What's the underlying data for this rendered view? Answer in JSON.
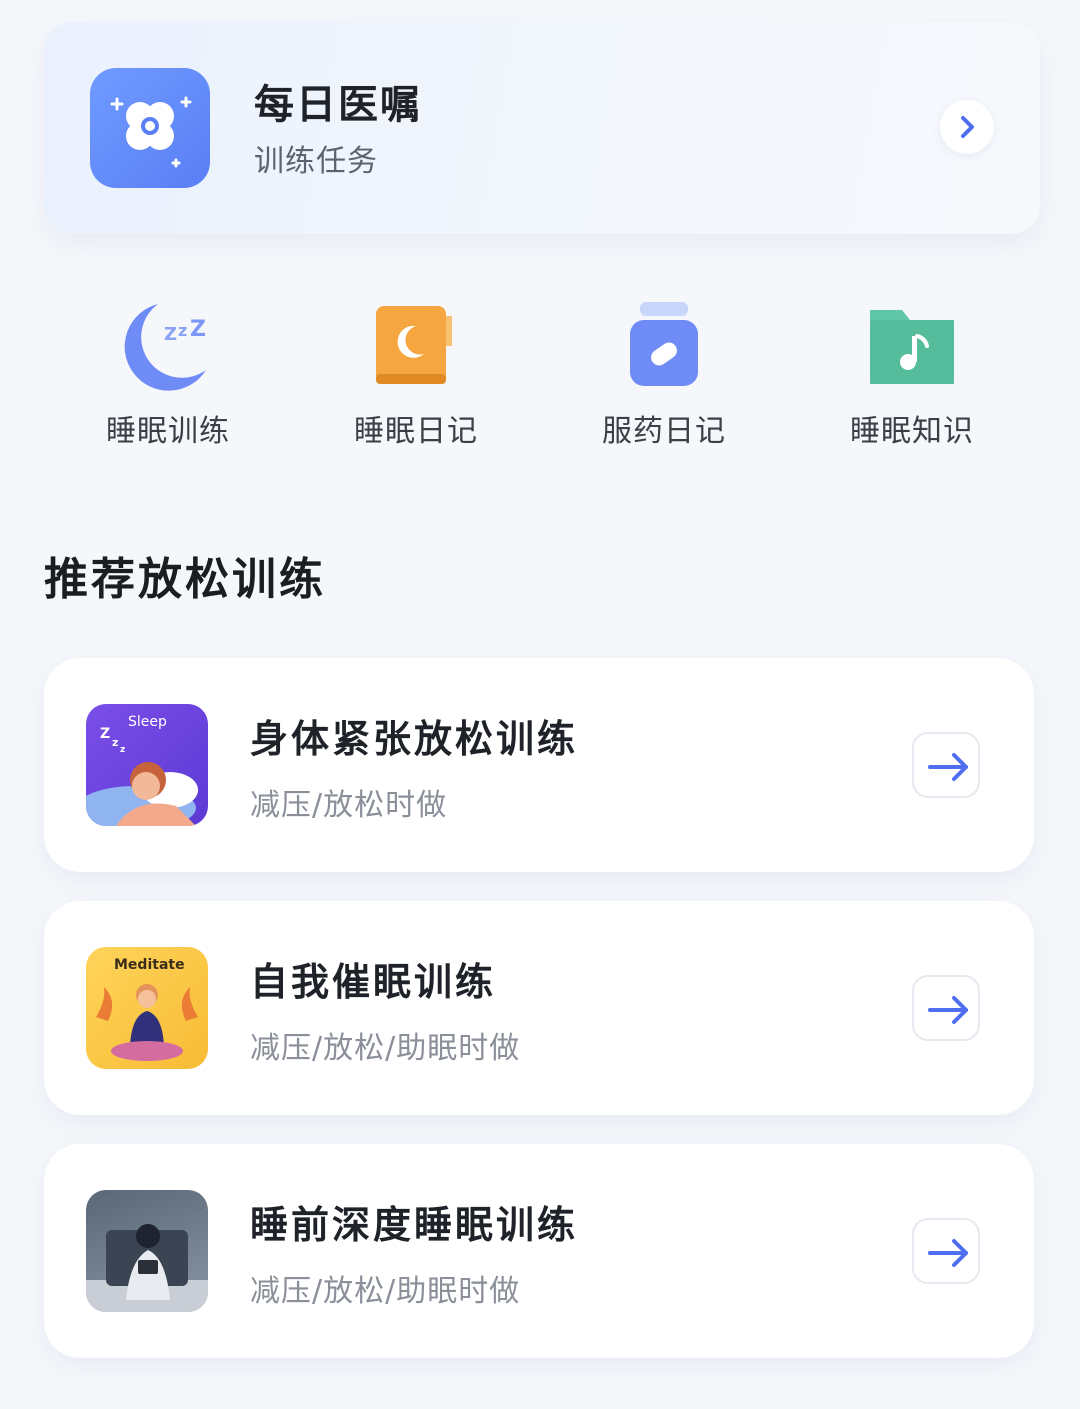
{
  "daily_card": {
    "title": "每日医嘱",
    "subtitle": "训练任务",
    "icon": "clover-icon"
  },
  "quick_actions": [
    {
      "label": "睡眠训练",
      "icon": "moon-sleep-icon",
      "color": "#6f8cf6"
    },
    {
      "label": "睡眠日记",
      "icon": "diary-book-icon",
      "color": "#f5a640"
    },
    {
      "label": "服药日记",
      "icon": "pill-bottle-icon",
      "color": "#6f8cf6"
    },
    {
      "label": "睡眠知识",
      "icon": "music-folder-icon",
      "color": "#5fc6a6"
    }
  ],
  "section": {
    "title": "推荐放松训练"
  },
  "recommendations": [
    {
      "title": "身体紧张放松训练",
      "subtitle": "减压/放松时做",
      "thumb_text": "Sleep",
      "thumb": "sleep-illustration"
    },
    {
      "title": "自我催眠训练",
      "subtitle": "减压/放松/助眠时做",
      "thumb_text": "Meditate",
      "thumb": "meditate-illustration"
    },
    {
      "title": "睡前深度睡眠训练",
      "subtitle": "减压/放松/助眠时做",
      "thumb": "bedtime-photo"
    }
  ],
  "colors": {
    "accent": "#4f6ef0",
    "background": "#f5f7fb"
  }
}
